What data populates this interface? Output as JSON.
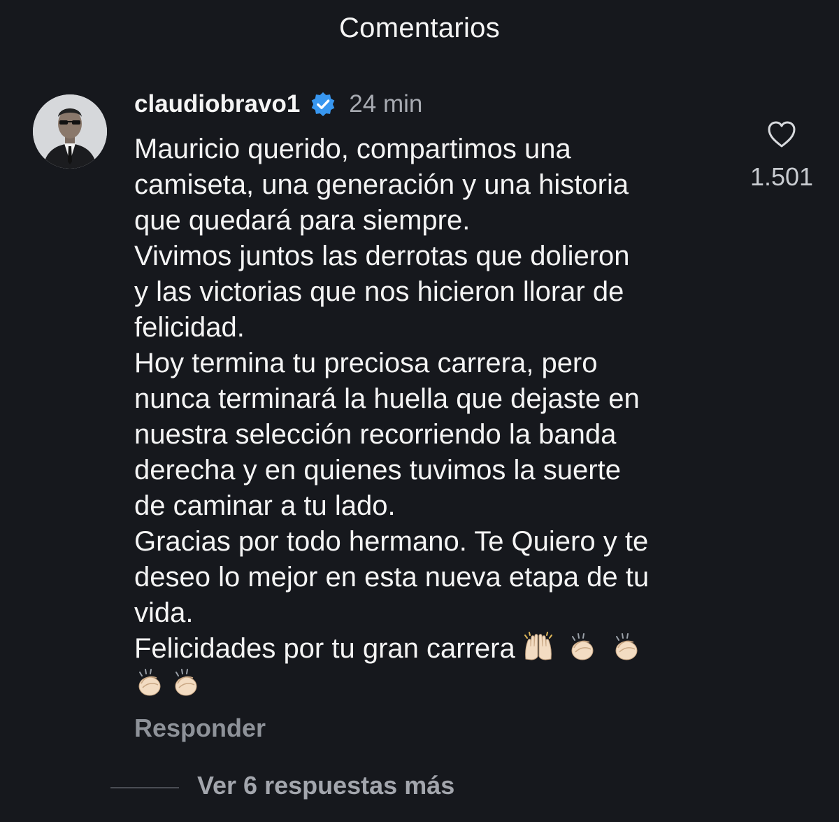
{
  "header": {
    "title": "Comentarios"
  },
  "comment": {
    "username": "claudiobravo1",
    "verified_icon": "verified-badge-icon",
    "timestamp": "24 min",
    "lines": [
      "Mauricio querido, compartimos una",
      "camiseta, una generación y una historia",
      "que quedará para siempre.",
      "Vivimos juntos las derrotas que dolieron",
      "y las victorias que nos hicieron llorar de",
      "felicidad.",
      "Hoy termina tu preciosa carrera, pero",
      "nunca terminará la huella que dejaste en",
      "nuestra selección recorriendo la banda",
      "derecha y en quienes tuvimos la suerte",
      "de caminar a tu lado.",
      "Gracias por todo hermano. Te Quiero y te",
      "deseo lo mejor en esta nueva etapa de tu",
      "vida.",
      "Felicidades por tu gran carrera"
    ],
    "emojis_line1": [
      "raised-hands-icon",
      "clapping-hands-icon",
      "clapping-hands-icon"
    ],
    "emojis_line2": [
      "clapping-hands-icon",
      "clapping-hands-icon"
    ],
    "like_icon": "heart-icon",
    "like_count": "1.501",
    "reply_label": "Responder",
    "more_replies_label": "Ver 6 respuestas más"
  },
  "colors": {
    "background": "#16181d",
    "text_primary": "#f4f4f4",
    "text_secondary": "#a8abb2",
    "verified_blue": "#3897f0"
  }
}
